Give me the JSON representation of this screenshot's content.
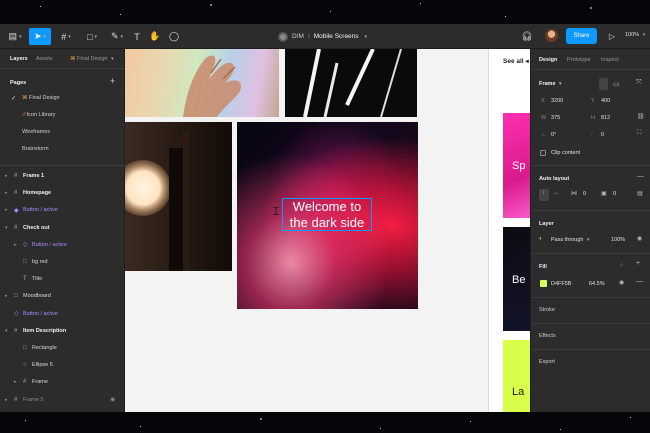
{
  "toolbar": {
    "breadcrumb_team": "DIM",
    "breadcrumb_sep": "/",
    "breadcrumb_file": "Mobile Screens",
    "share_label": "Share",
    "zoom": "100%"
  },
  "left_panel": {
    "tabs": [
      "Layers",
      "Assets",
      "Final Design"
    ],
    "pages_title": "Pages",
    "pages": [
      "Final Design",
      "Icon Library",
      "Wireframes",
      "Brainstorm"
    ],
    "current_page_index": 0,
    "layers": [
      {
        "name": "Frame 1",
        "style": "bold",
        "icon": "#",
        "indent": 0,
        "caret": "▸"
      },
      {
        "name": "Homepage",
        "style": "bold",
        "icon": "#",
        "indent": 0,
        "caret": "▸"
      },
      {
        "name": "Button / active",
        "style": "purple",
        "icon": "◆",
        "indent": 0,
        "caret": "▸"
      },
      {
        "name": "Check out",
        "style": "bold",
        "icon": "#",
        "indent": 0,
        "caret": "▾"
      },
      {
        "name": "Button / active",
        "style": "purple",
        "icon": "◇",
        "indent": 1,
        "caret": "▸"
      },
      {
        "name": "bg red",
        "style": "normal",
        "icon": "□",
        "indent": 1,
        "caret": ""
      },
      {
        "name": "Title",
        "style": "normal",
        "icon": "T",
        "indent": 1,
        "caret": ""
      },
      {
        "name": "Moodboard",
        "style": "normal",
        "icon": "□",
        "indent": 0,
        "caret": "▸"
      },
      {
        "name": "Button / active",
        "style": "purple",
        "icon": "◇",
        "indent": 0,
        "caret": ""
      },
      {
        "name": "Item Description",
        "style": "bold",
        "icon": "#",
        "indent": 0,
        "caret": "▾"
      },
      {
        "name": "Rectangle",
        "style": "normal",
        "icon": "□",
        "indent": 1,
        "caret": ""
      },
      {
        "name": "Ellipse 5",
        "style": "normal",
        "icon": "○",
        "indent": 1,
        "caret": ""
      },
      {
        "name": "Frame",
        "style": "normal",
        "icon": "#",
        "indent": 1,
        "caret": "▸"
      },
      {
        "name": "Frame 5",
        "style": "dim",
        "icon": "#",
        "indent": 0,
        "caret": "▸"
      }
    ]
  },
  "canvas": {
    "welcome_text": "Welcome to the dark side",
    "see_all": "See all",
    "card1_text": "Sp",
    "card2_text": "Be",
    "card3_text": "La"
  },
  "right_panel": {
    "tabs": [
      "Design",
      "Prototype",
      "Inspect"
    ],
    "frame_label": "Frame",
    "x_label": "X",
    "x_value": "3200",
    "y_label": "Y",
    "y_value": "400",
    "w_label": "W",
    "w_value": "375",
    "h_label": "H",
    "h_value": "812",
    "rotation_value": "0°",
    "radius_value": "0",
    "clip_content": "Clip content",
    "auto_layout_title": "Auto layout",
    "al_gap": "0",
    "al_padding": "0",
    "layer_title": "Layer",
    "blend_mode": "Pass through",
    "layer_opacity": "100%",
    "fill_title": "Fill",
    "fill_hex": "D4FF5B",
    "fill_opacity": "64.5%",
    "fill_color": "#d4ff5b",
    "stroke_title": "Stroke",
    "effects_title": "Effects",
    "export_title": "Export"
  },
  "colors": {
    "accent": "#0d99ff",
    "panel": "#2c2c2c",
    "component": "#a98cff"
  }
}
